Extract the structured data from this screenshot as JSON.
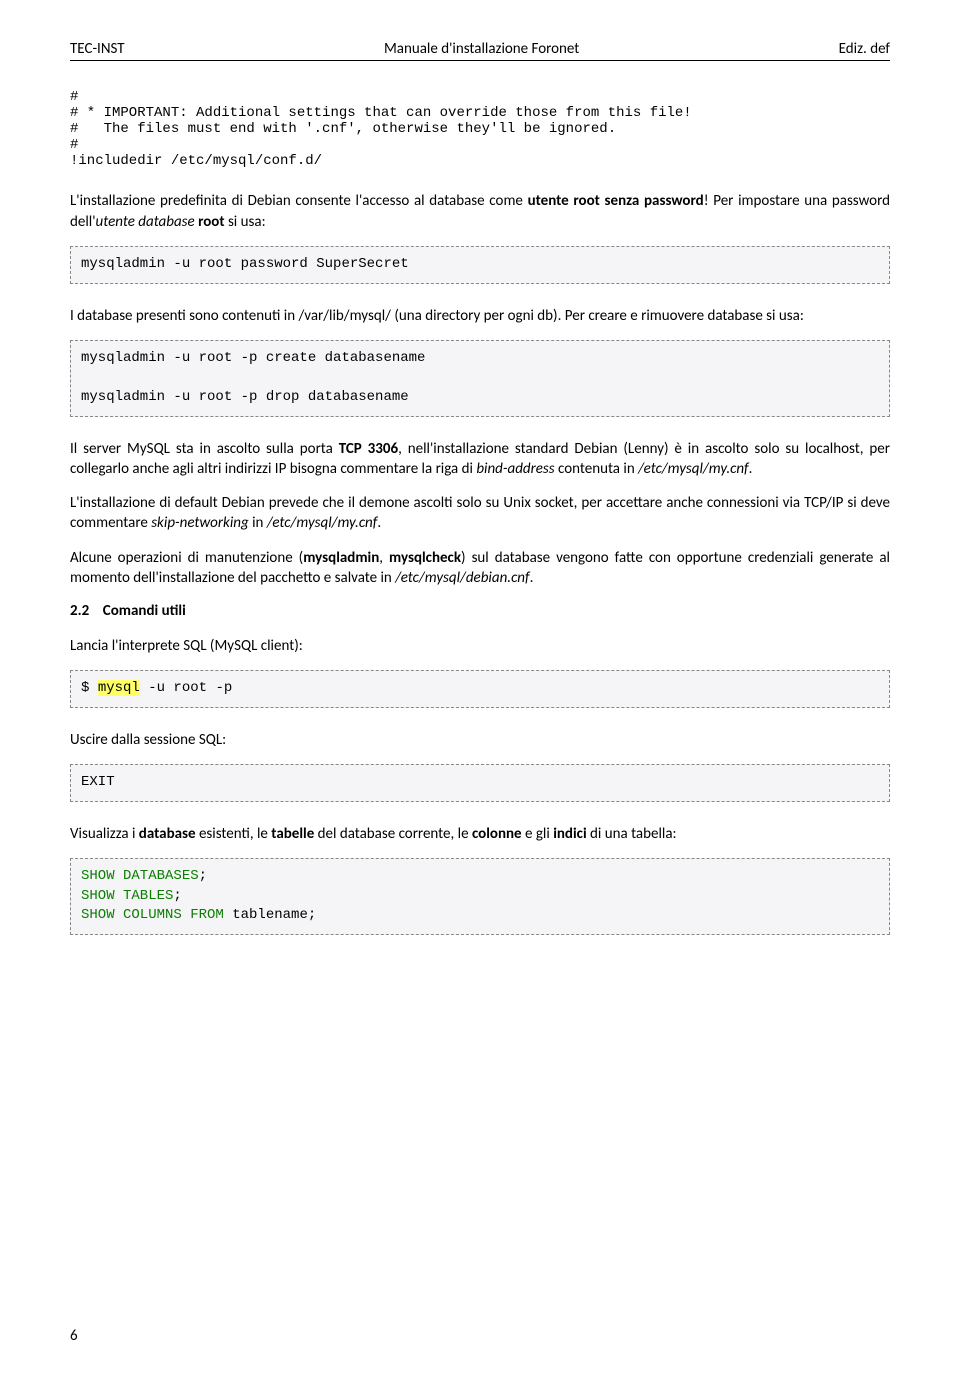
{
  "header": {
    "left": "TEC-INST",
    "center": "Manuale d'installazione Foronet",
    "right": "Ediz. def"
  },
  "code1": "#\n# * IMPORTANT: Additional settings that can override those from this file!\n#   The files must end with '.cnf', otherwise they'll be ignored.\n#\n!includedir /etc/mysql/conf.d/",
  "para1_a": "L'installazione predefinita di Debian consente l'accesso al database come ",
  "para1_b": "utente root senza password",
  "para1_c": "! Per impostare una password dell'",
  "para1_d": "utente database",
  "para1_e": " ",
  "para1_f": "root",
  "para1_g": " si usa:",
  "code2": "mysqladmin -u root password SuperSecret",
  "para2_a": "I database presenti sono contenuti in /var/lib/mysql/ (una directory per ogni db). Per creare e rimuovere database si usa:",
  "code3": "mysqladmin -u root -p create databasename\n\nmysqladmin -u root -p drop databasename",
  "para3_a": "Il server MySQL sta in ascolto sulla porta ",
  "para3_b": "TCP 3306",
  "para3_c": ", nell'installazione standard Debian (Lenny) è in ascolto solo su localhost, per collegarlo anche agli altri indirizzi IP bisogna commentare la riga di ",
  "para3_d": "bind-address",
  "para3_e": " contenuta in ",
  "para3_f": "/etc/mysql/my.cnf",
  "para3_g": ".",
  "para4_a": "L'installazione di default Debian prevede che il demone ascolti solo su Unix socket, per accettare anche connessioni via TCP/IP si deve commentare ",
  "para4_b": "skip-networking",
  "para4_c": "  in ",
  "para4_d": "/etc/mysql/my.cnf",
  "para4_e": ".",
  "para5_a": "Alcune operazioni di manutenzione (",
  "para5_b": "mysqladmin",
  "para5_c": ", ",
  "para5_d": "mysqlcheck",
  "para5_e": ") sul database vengono fatte con opportune credenziali generate al momento dell'installazione del pacchetto e salvate in ",
  "para5_f": "/etc/mysql/debian.cnf",
  "para5_g": ".",
  "section": {
    "num": "2.2",
    "title": "Comandi utili"
  },
  "para6": "Lancia l'interprete SQL (MySQL client):",
  "code4_a": "$ ",
  "code4_b": "mysql",
  "code4_c": " -u root -p",
  "para7": "Uscire dalla sessione SQL:",
  "code5": "EXIT",
  "para8_a": "Visualizza i ",
  "para8_b": "database",
  "para8_c": " esistenti, le ",
  "para8_d": "tabelle",
  "para8_e": " del database corrente, le ",
  "para8_f": "colonne",
  "para8_g": " e gli ",
  "para8_h": "indici",
  "para8_i": " di una tabella:",
  "code6_a": "SHOW DATABASES",
  "code6_b": "SHOW TABLES",
  "code6_c": "SHOW COLUMNS FROM",
  "code6_d": " tablename",
  "semicolon": ";",
  "pagenum": "6"
}
